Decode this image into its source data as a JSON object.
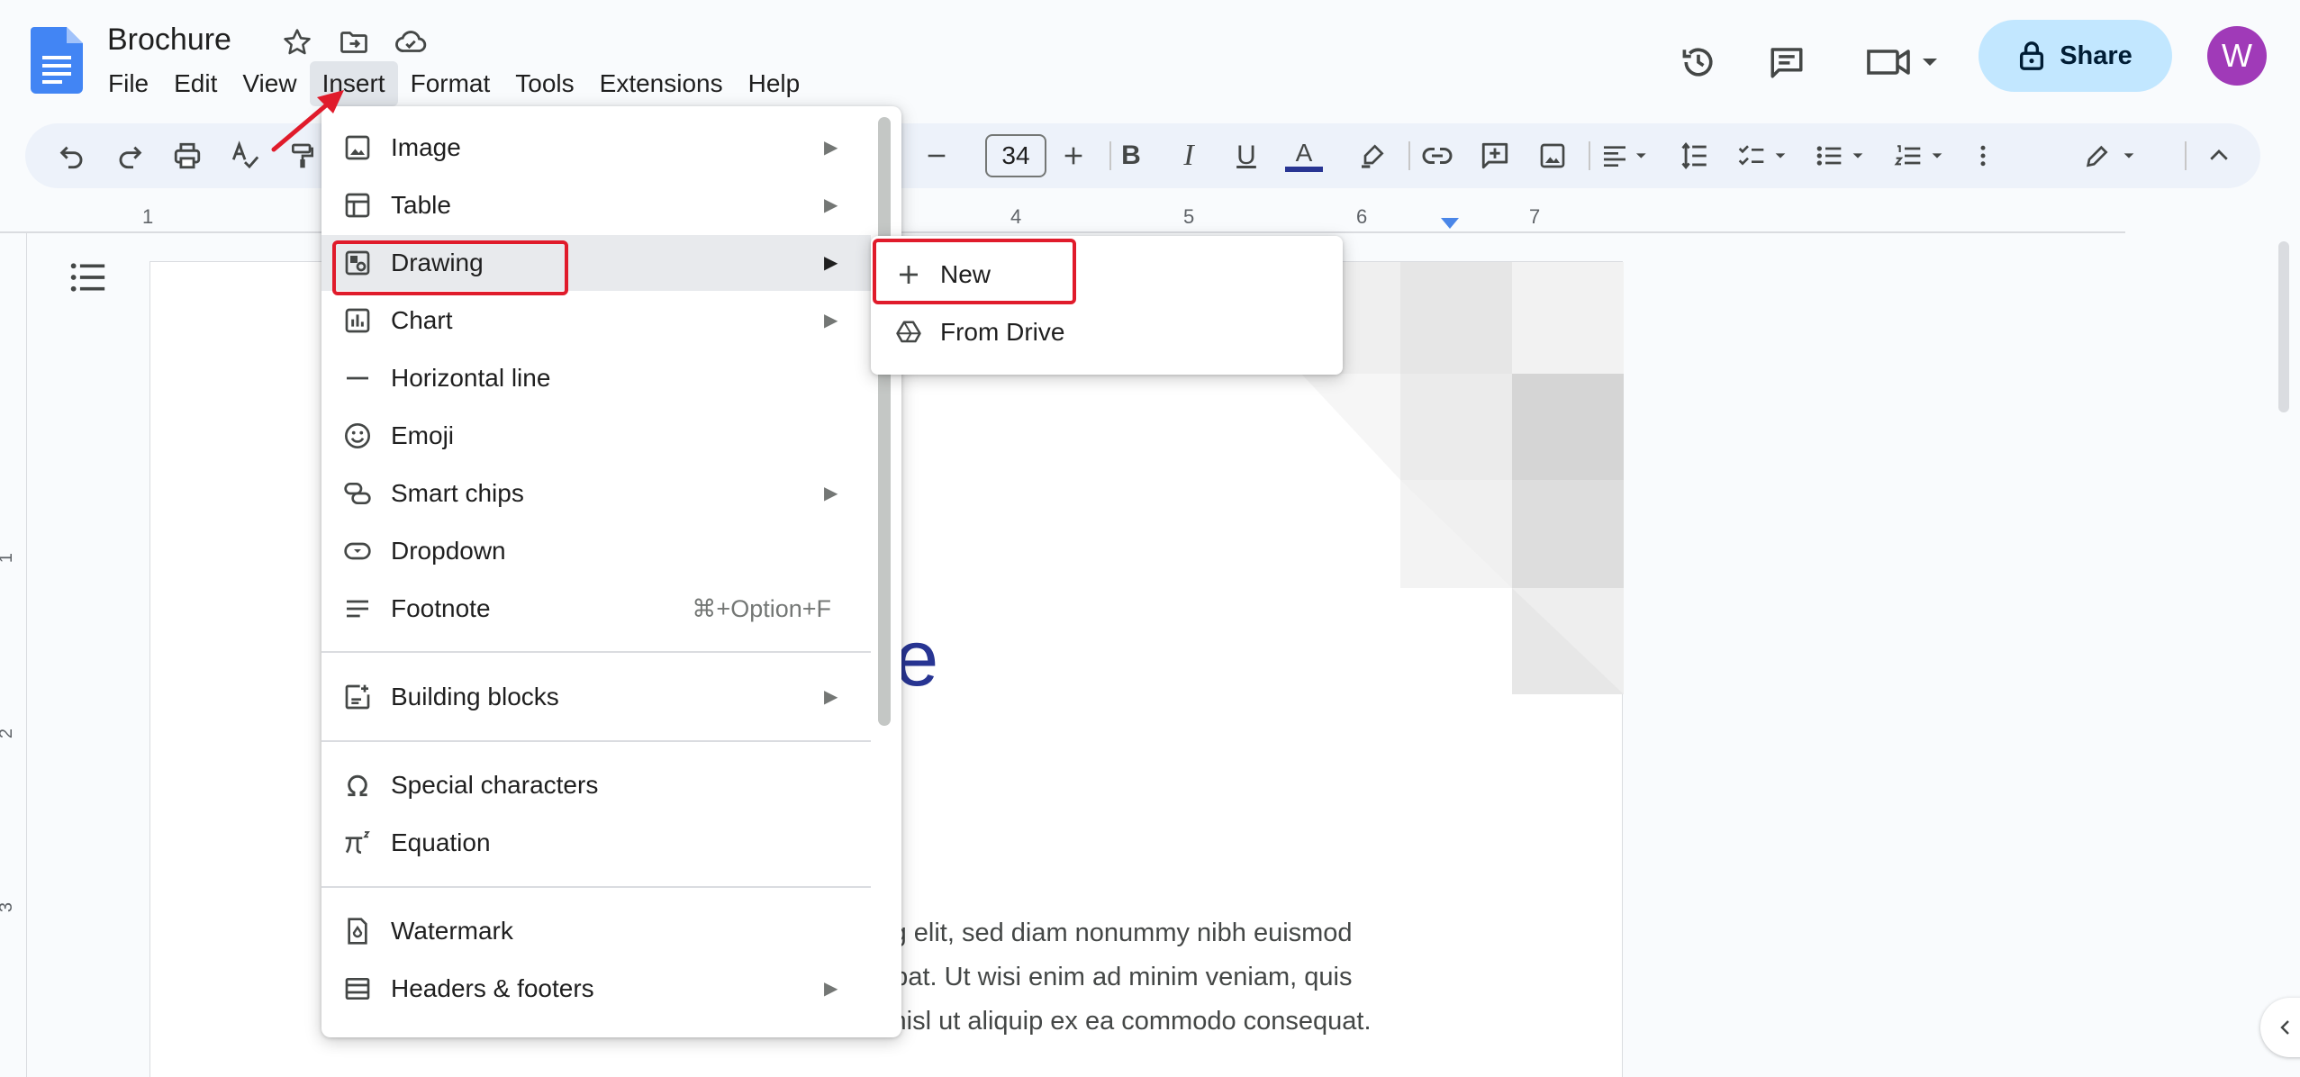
{
  "document": {
    "title": "Brochure",
    "title_fragment": "re",
    "body_lines": [
      "ing elit, sed diam nonummy nibh euismod",
      "utpat. Ut wisi enim ad minim veniam, quis",
      "s nisl ut aliquip ex ea commodo consequat."
    ]
  },
  "menubar": {
    "items": [
      "File",
      "Edit",
      "View",
      "Insert",
      "Format",
      "Tools",
      "Extensions",
      "Help"
    ],
    "active": "Insert"
  },
  "header": {
    "share_label": "Share",
    "avatar_initial": "W",
    "icons": [
      "star-icon",
      "move-to-folder-icon",
      "cloud-saved-icon",
      "version-history-icon",
      "comments-icon",
      "meet-icon",
      "lock-icon"
    ]
  },
  "toolbar": {
    "font_size": "34",
    "bold_label": "B",
    "italic_label": "I",
    "underline_label": "U",
    "text_color_label": "A",
    "text_color": "#283593"
  },
  "ruler": {
    "h_numbers": [
      "1",
      "4",
      "5",
      "6",
      "7"
    ],
    "v_numbers": [
      "1",
      "2",
      "3"
    ]
  },
  "insert_menu": {
    "items": [
      {
        "label": "Image",
        "submenu": true,
        "icon": "image-icon"
      },
      {
        "label": "Table",
        "submenu": true,
        "icon": "table-icon"
      },
      {
        "label": "Drawing",
        "submenu": true,
        "icon": "drawing-icon",
        "highlighted": true
      },
      {
        "label": "Chart",
        "submenu": true,
        "icon": "chart-icon"
      },
      {
        "label": "Horizontal line",
        "submenu": false,
        "icon": "horizontal-line-icon"
      },
      {
        "label": "Emoji",
        "submenu": false,
        "icon": "emoji-icon"
      },
      {
        "label": "Smart chips",
        "submenu": true,
        "icon": "smart-chips-icon"
      },
      {
        "label": "Dropdown",
        "submenu": false,
        "icon": "dropdown-icon"
      },
      {
        "label": "Footnote",
        "submenu": false,
        "icon": "footnote-icon",
        "shortcut": "⌘+Option+F"
      },
      {
        "label": "Building blocks",
        "submenu": true,
        "icon": "building-blocks-icon"
      },
      {
        "label": "Special characters",
        "submenu": false,
        "icon": "omega-icon"
      },
      {
        "label": "Equation",
        "submenu": false,
        "icon": "pi-icon"
      },
      {
        "label": "Watermark",
        "submenu": false,
        "icon": "watermark-icon"
      },
      {
        "label": "Headers & footers",
        "submenu": true,
        "icon": "headers-footers-icon"
      }
    ],
    "arrow_glyph": "▶"
  },
  "drawing_submenu": {
    "items": [
      {
        "label": "New",
        "icon": "plus-icon",
        "highlighted": true
      },
      {
        "label": "From Drive",
        "icon": "drive-icon"
      }
    ]
  },
  "colors": {
    "accent": "#1a73e8",
    "share_bg": "#c2e7ff",
    "avatar_bg": "#a03ab8",
    "annotation_red": "#e01b2b",
    "title_blue": "#283593"
  }
}
